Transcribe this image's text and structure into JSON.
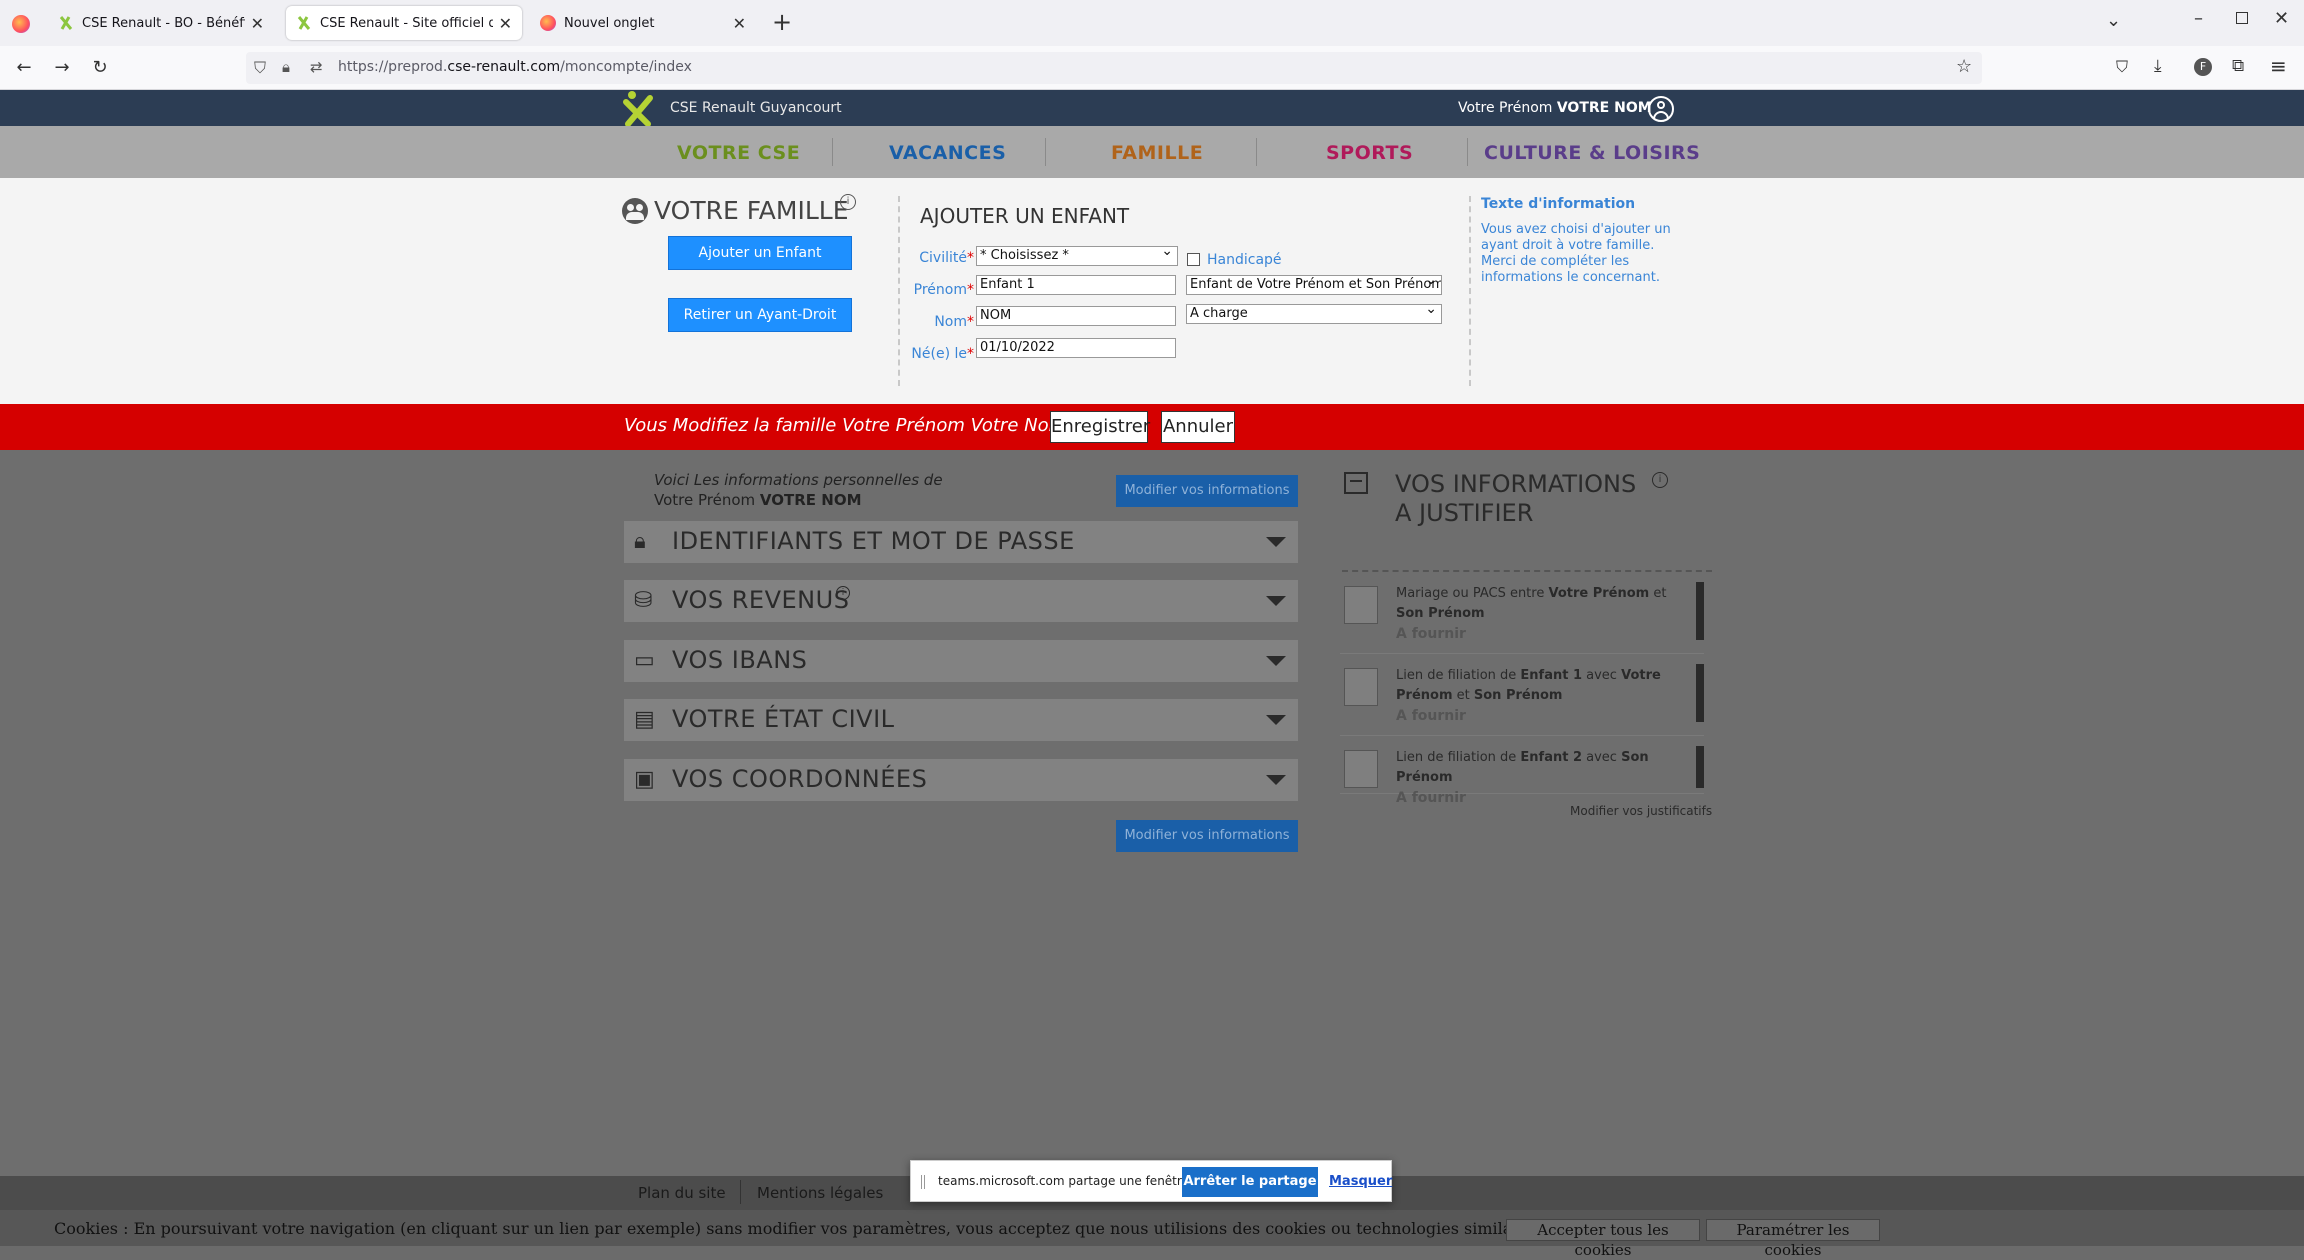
{
  "browser": {
    "tabs": [
      {
        "title": "CSE Renault - BO - Bénéficiaires"
      },
      {
        "title": "CSE Renault - Site officiel du Co"
      },
      {
        "title": "Nouvel onglet"
      }
    ],
    "url_prefix": "https://preprod.",
    "url_domain": "cse-renault.com",
    "url_path": "/moncompte/index"
  },
  "site": {
    "brand": "CSE Renault Guyancourt",
    "user_first": "Votre Prénom",
    "user_last": "VOTRE NOM",
    "menu": [
      {
        "label": "VOTRE CSE",
        "color": "#6b8f1e"
      },
      {
        "label": "VACANCES",
        "color": "#1a5fa8"
      },
      {
        "label": "FAMILLE",
        "color": "#b0631a"
      },
      {
        "label": "SPORTS",
        "color": "#b01a5a"
      },
      {
        "label": "CULTURE & LOISIRS",
        "color": "#5a3d8a"
      }
    ]
  },
  "family": {
    "title": "VOTRE FAMILLE",
    "add_child": "Ajouter un Enfant",
    "remove": "Retirer un Ayant-Droit",
    "form_title": "AJOUTER UN ENFANT",
    "civility_label": "Civilité",
    "civility_value": "* Choisissez *",
    "handicap_label": "Handicapé",
    "firstname_label": "Prénom",
    "firstname_value": "Enfant 1",
    "relation_value": "Enfant de Votre Prénom et Son Prénom",
    "lastname_label": "Nom",
    "lastname_value": "NOM",
    "charge_value": "A charge",
    "birth_label": "Né(e) le",
    "birth_value": "01/10/2022",
    "info_title": "Texte d'information",
    "info_text": "Vous avez choisi d'ajouter un ayant droit à votre famille. Merci de compléter les informations le concernant."
  },
  "edit_bar": {
    "message": "Vous Modifiez la famille Votre Prénom Votre Nom",
    "save": "Enregistrer",
    "cancel": "Annuler"
  },
  "personal": {
    "intro": "Voici Les informations personnelles de",
    "name_first": "Votre Prénom",
    "name_last": "VOTRE NOM",
    "modify": "Modifier vos informations",
    "sections": [
      {
        "label": "IDENTIFIANTS ET MOT DE PASSE",
        "icon": "lock-icon"
      },
      {
        "label": "VOS REVENUS",
        "icon": "coins-icon"
      },
      {
        "label": "VOS IBANS",
        "icon": "card-icon"
      },
      {
        "label": "VOTRE ÉTAT CIVIL",
        "icon": "id-card-icon"
      },
      {
        "label": "VOS COORDONNÉES",
        "icon": "wallet-icon"
      }
    ]
  },
  "justify": {
    "title_line1": "VOS INFORMATIONS",
    "title_line2": "A JUSTIFIER",
    "status": "A fournir",
    "modify": "Modifier vos justificatifs"
  },
  "footer": {
    "links": [
      "Plan du site",
      "Mentions légales"
    ],
    "cookie_text": "Cookies : En poursuivant votre navigation (en cliquant sur un lien par exemple) sans modifier vos paramètres, vous acceptez que nous utilisions des cookies ou technologies similaires.",
    "accept": "Accepter tous les cookies",
    "settings": "Paramétrer les cookies"
  },
  "share": {
    "text": "teams.microsoft.com partage une fenêtre.",
    "stop": "Arrêter le partage",
    "hide": "Masquer"
  }
}
